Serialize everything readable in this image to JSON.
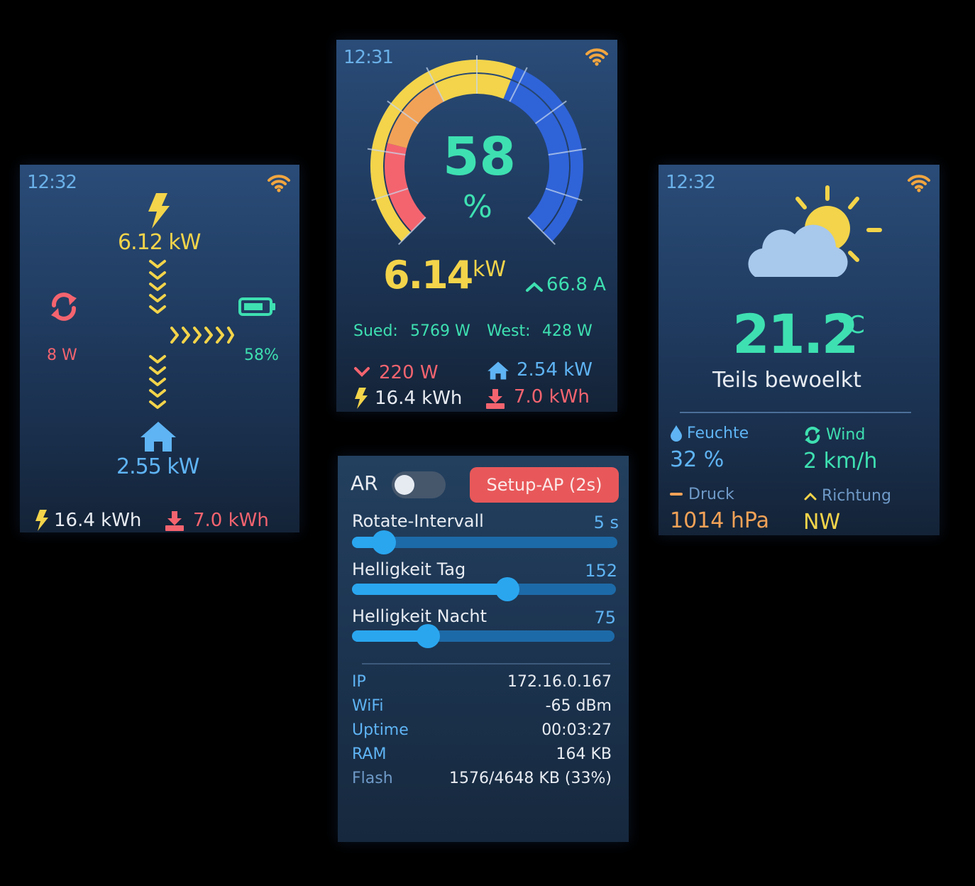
{
  "energy_flow": {
    "time": "12:32",
    "pv_power": "6.12 kW",
    "grid_power": "8 W",
    "battery_soc": "58%",
    "house_power": "2.55 kW",
    "pv_energy": "16.4 kWh",
    "grid_import": "7.0 kWh",
    "icons": [
      "wifi-icon",
      "lightning-icon",
      "sync-icon",
      "battery-icon",
      "house-icon",
      "download-icon"
    ]
  },
  "gauge_screen": {
    "time": "12:31",
    "percent_value": "58",
    "percent_unit": "%",
    "power_value": "6.14",
    "power_unit": "kW",
    "current": "66.8 A",
    "sued_label": "Sued:",
    "sued_value": "5769 W",
    "west_label": "West:",
    "west_value": "428 W",
    "grid_value": "220 W",
    "house_value": "2.54 kW",
    "pv_energy": "16.4 kWh",
    "grid_import": "7.0 kWh",
    "percent_level": 0.58,
    "colors": {
      "red": "#f4646f",
      "orange": "#f2a257",
      "yellow": "#f3d44a",
      "blue": "#2f63d8"
    }
  },
  "weather": {
    "time": "12:32",
    "temperature": "21.2",
    "temp_unit": "°C",
    "condition": "Teils bewoelkt",
    "humidity_label": "Feuchte",
    "humidity_value": "32 %",
    "wind_label": "Wind",
    "wind_value": "2 km/h",
    "pressure_label": "Druck",
    "pressure_value": "1014 hPa",
    "direction_label": "Richtung",
    "direction_value": "NW",
    "icons": [
      "wifi-icon",
      "partly-cloudy-icon",
      "droplet-icon",
      "sync-icon",
      "minus-icon",
      "chevron-up-icon"
    ]
  },
  "settings": {
    "ar_label": "AR",
    "ar_on": false,
    "setup_button": "Setup-AP (2s)",
    "sliders": [
      {
        "label": "Rotate-Intervall",
        "value_text": "5 s",
        "level": 0.12
      },
      {
        "label": "Helligkeit Tag",
        "value_text": "152",
        "level": 0.59
      },
      {
        "label": "Helligkeit Nacht",
        "value_text": "75",
        "level": 0.29
      }
    ],
    "info": [
      {
        "key": "IP",
        "value": "172.16.0.167"
      },
      {
        "key": "WiFi",
        "value": "-65 dBm"
      },
      {
        "key": "Uptime",
        "value": "00:03:27"
      },
      {
        "key": "RAM",
        "value": "164 KB"
      },
      {
        "key": "Flash",
        "value": "1576/4648 KB (33%)"
      }
    ]
  }
}
